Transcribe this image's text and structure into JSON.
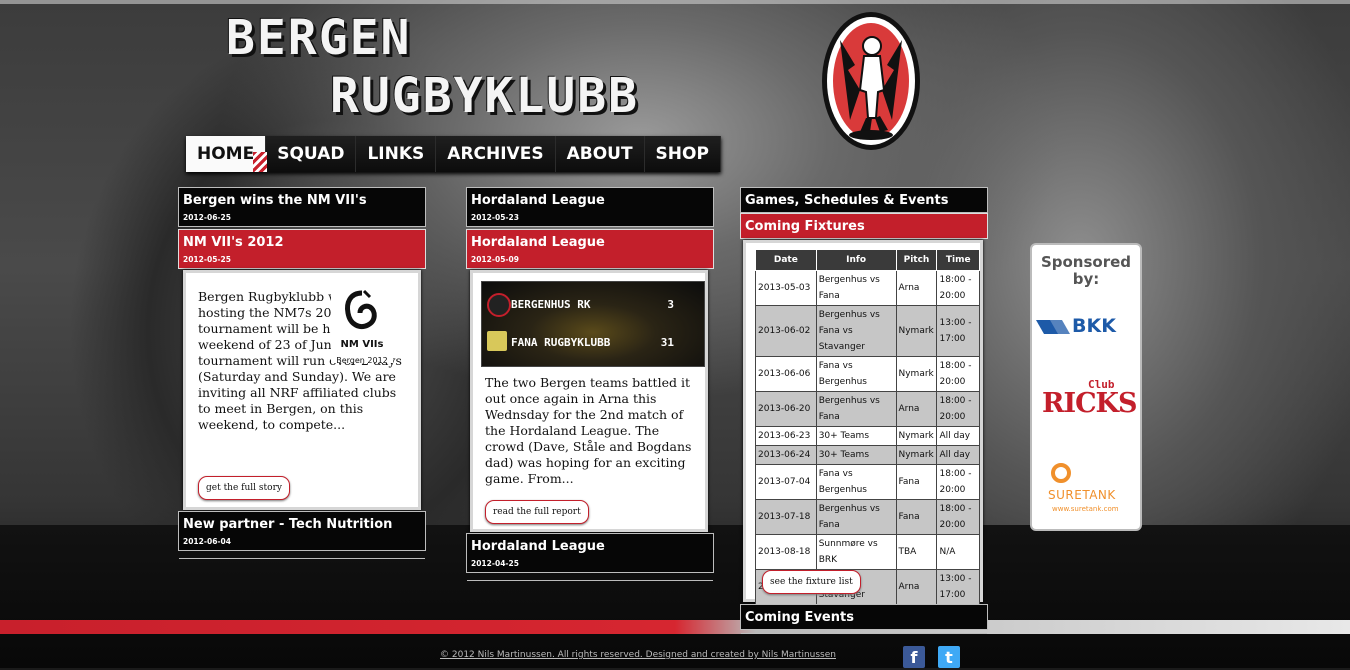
{
  "header": {
    "title_line1": "BERGEN",
    "title_line2": "RUGBYKLUBB"
  },
  "nav": {
    "items": [
      {
        "label": "HOME"
      },
      {
        "label": "SQUAD"
      },
      {
        "label": "LINKS"
      },
      {
        "label": "ARCHIVES"
      },
      {
        "label": "ABOUT"
      },
      {
        "label": "SHOP"
      }
    ]
  },
  "column1": {
    "posts": [
      {
        "title": "Bergen wins the NM VII's",
        "date": "2012-06-25"
      },
      {
        "title": "NM VII's 2012",
        "date": "2012-05-25"
      },
      {
        "title": "New partner - Tech Nutrition",
        "date": "2012-06-04"
      }
    ],
    "card": {
      "body": "Bergen Rugbyklubb will be hosting the NM7s 2012. The tournament will be held the weekend of 23 of June. The tournament will run over 2 days (Saturday and Sunday). We are inviting all NRF affiliated clubs to meet in Bergen, on this weekend, to compete...",
      "logo_big": "NM VIIs",
      "logo_small": "Bergen 2012",
      "button": "get the full story"
    }
  },
  "column2": {
    "posts": [
      {
        "title": "Hordaland League",
        "date": "2012-05-23"
      },
      {
        "title": "Hordaland League",
        "date": "2012-05-09"
      },
      {
        "title": "Hordaland League",
        "date": "2012-04-25"
      }
    ],
    "card": {
      "scoreboard": [
        {
          "team": "BERGENHUS RK",
          "score": "3"
        },
        {
          "team": "FANA RUGBYKLUBB",
          "score": "31"
        }
      ],
      "body": "The two Bergen teams battled it out once again in Arna this Wednsday for the 2nd match of the Hordaland League. The crowd (Dave, Ståle and Bogdans dad) was hoping for an exciting game. From...",
      "button": "read the full report"
    }
  },
  "column3": {
    "header": "Games, Schedules & Events",
    "subheader": "Coming Fixtures",
    "fixtures": {
      "columns": [
        "Date",
        "Info",
        "Pitch",
        "Time"
      ],
      "rows": [
        [
          "2013-05-03",
          "Bergenhus vs Fana",
          "Arna",
          "18:00 - 20:00"
        ],
        [
          "2013-06-02",
          "Bergenhus vs Fana vs Stavanger",
          "Nymark",
          "13:00 - 17:00"
        ],
        [
          "2013-06-06",
          "Fana vs Bergenhus",
          "Nymark",
          "18:00 - 20:00"
        ],
        [
          "2013-06-20",
          "Bergenhus vs Fana",
          "Arna",
          "18:00 - 20:00"
        ],
        [
          "2013-06-23",
          "30+ Teams",
          "Nymark",
          "All day"
        ],
        [
          "2013-06-24",
          "30+ Teams",
          "Nymark",
          "All day"
        ],
        [
          "2013-07-04",
          "Fana vs Bergenhus",
          "Fana",
          "18:00 - 20:00"
        ],
        [
          "2013-07-18",
          "Bergenhus vs Fana",
          "Fana",
          "18:00 - 20:00"
        ],
        [
          "2013-08-18",
          "Sunnmøre vs BRK",
          "TBA",
          "N/A"
        ],
        [
          "2013-08-25",
          "BRK vs Stavanger",
          "Arna",
          "13:00 - 17:00"
        ]
      ],
      "button": "see the fixture list"
    },
    "events_header": "Coming Events"
  },
  "sponsors": {
    "heading": "Sponsored by:",
    "items": [
      {
        "name": "BKK"
      },
      {
        "name_big": "RICKS",
        "name_small": "Club"
      },
      {
        "name": "SURETANK",
        "url_text": "www.suretank.com"
      }
    ]
  },
  "footer": {
    "text": "© 2012 Nils Martinussen. All rights reserved. Designed and created by Nils Martinussen"
  },
  "colors": {
    "accent_red": "#c31f2b",
    "nav_bg": "#111111",
    "facebook_blue": "#3b5998",
    "twitter_blue": "#3fa9f5"
  }
}
